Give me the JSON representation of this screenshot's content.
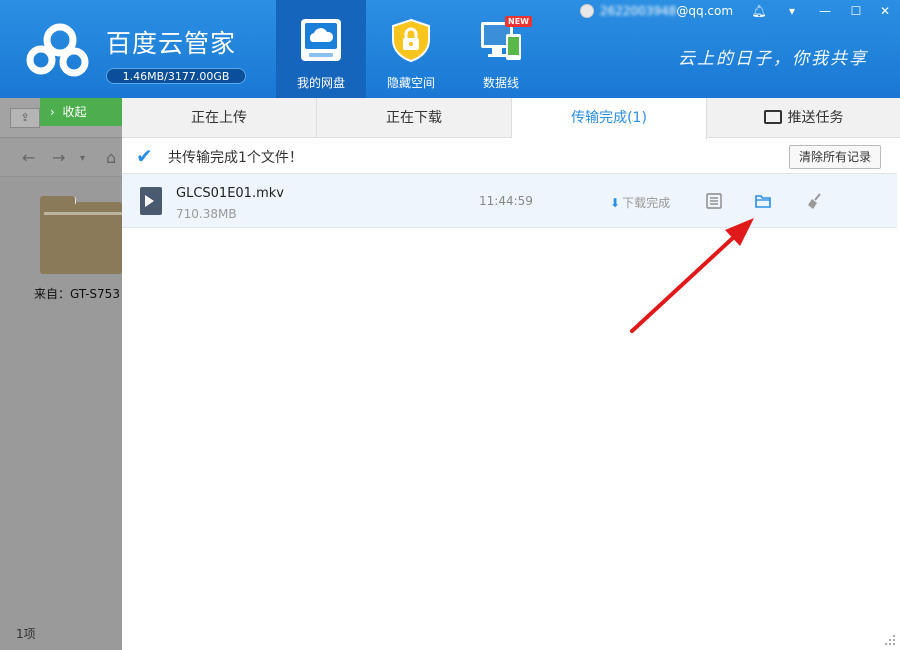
{
  "app": {
    "title": "百度云管家",
    "quota": "1.46MB/3177.00GB",
    "slogan": "云上的日子，你我共享"
  },
  "nav": {
    "disk": "我的网盘",
    "hidden": "隐藏空间",
    "data_line": "数据线",
    "new_badge": "NEW"
  },
  "user": {
    "email_blurred": "2622003948",
    "email_domain": "@qq.com"
  },
  "left_pane": {
    "upload_button": "⇪",
    "collapse": "收起",
    "folder_label": "来自：GT-S753",
    "item_count": "1项"
  },
  "tabs": {
    "uploading": "正在上传",
    "downloading": "正在下载",
    "completed": "传输完成(1)",
    "push": "推送任务"
  },
  "summary": {
    "text": "共传输完成1个文件！",
    "clear_button": "清除所有记录"
  },
  "file": {
    "name": "GLCS01E01.mkv",
    "size": "710.38MB",
    "time": "11:44:59",
    "status": "下载完成"
  },
  "colors": {
    "header": "#1f80d8",
    "accent": "#2a8ee6",
    "green": "#4cae4c",
    "arrow": "#e01a1a"
  }
}
